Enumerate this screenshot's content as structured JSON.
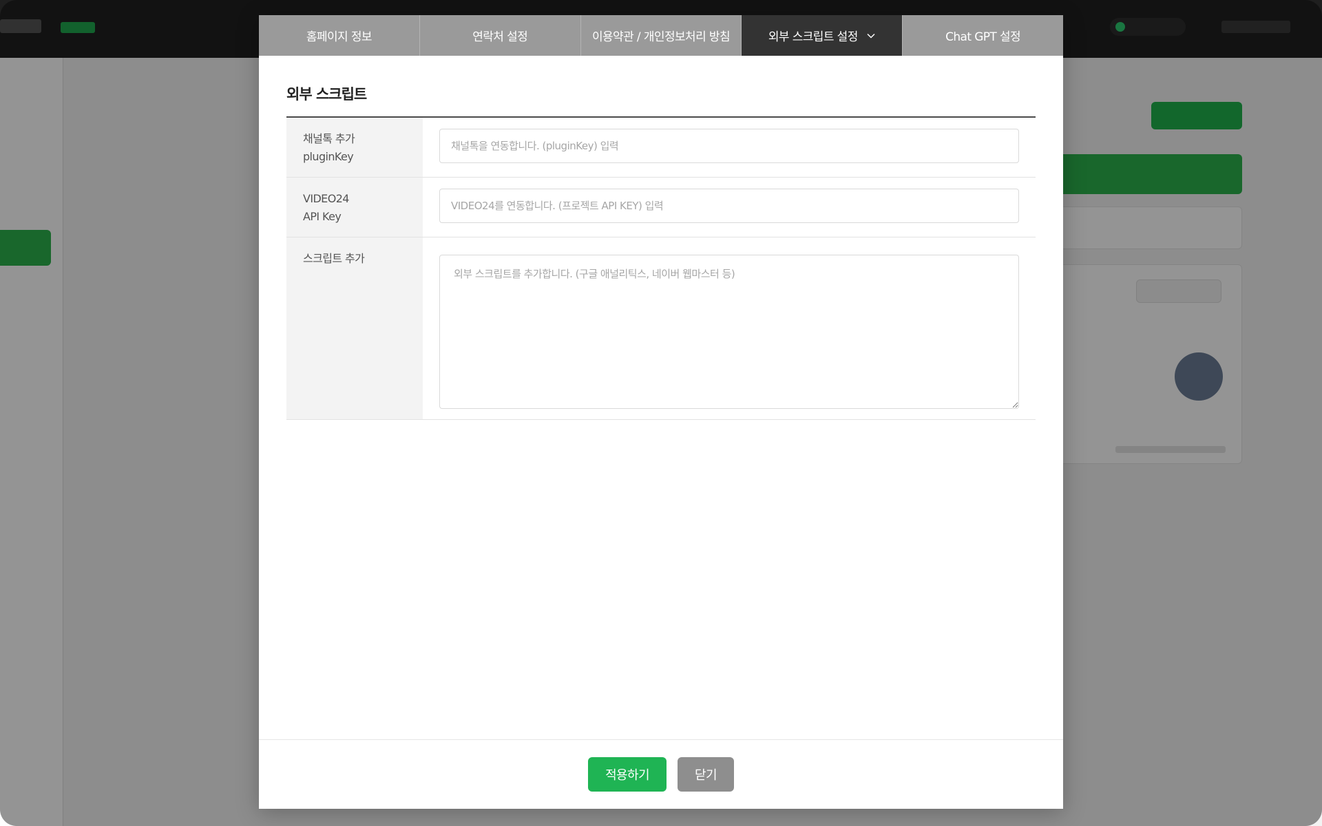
{
  "tabs": [
    {
      "label": "홈페이지 정보"
    },
    {
      "label": "연락처 설정"
    },
    {
      "label": "이용약관 / 개인정보처리 방침"
    },
    {
      "label": "외부 스크립트 설정",
      "active": true,
      "icon": "chevron-down-icon"
    },
    {
      "label": "Chat GPT 설정"
    }
  ],
  "section": {
    "title": "외부 스크립트"
  },
  "form": {
    "channeltalk": {
      "label_line1": "채널톡 추가",
      "label_line2": "pluginKey",
      "placeholder": "채널톡을 연동합니다. (pluginKey) 입력",
      "value": ""
    },
    "video24": {
      "label_line1": "VIDEO24",
      "label_line2": "API Key",
      "placeholder": "VIDEO24를 연동합니다. (프로젝트 API KEY) 입력",
      "value": ""
    },
    "script": {
      "label": "스크립트 추가",
      "placeholder": "외부 스크립트를 추가합니다. (구글 애널리틱스, 네이버 웹마스터 등)",
      "value": ""
    }
  },
  "footer": {
    "apply_label": "적용하기",
    "close_label": "닫기"
  },
  "colors": {
    "accent": "#1fb454",
    "active_tab": "#333333",
    "inactive_tab": "#9a9a9a"
  }
}
